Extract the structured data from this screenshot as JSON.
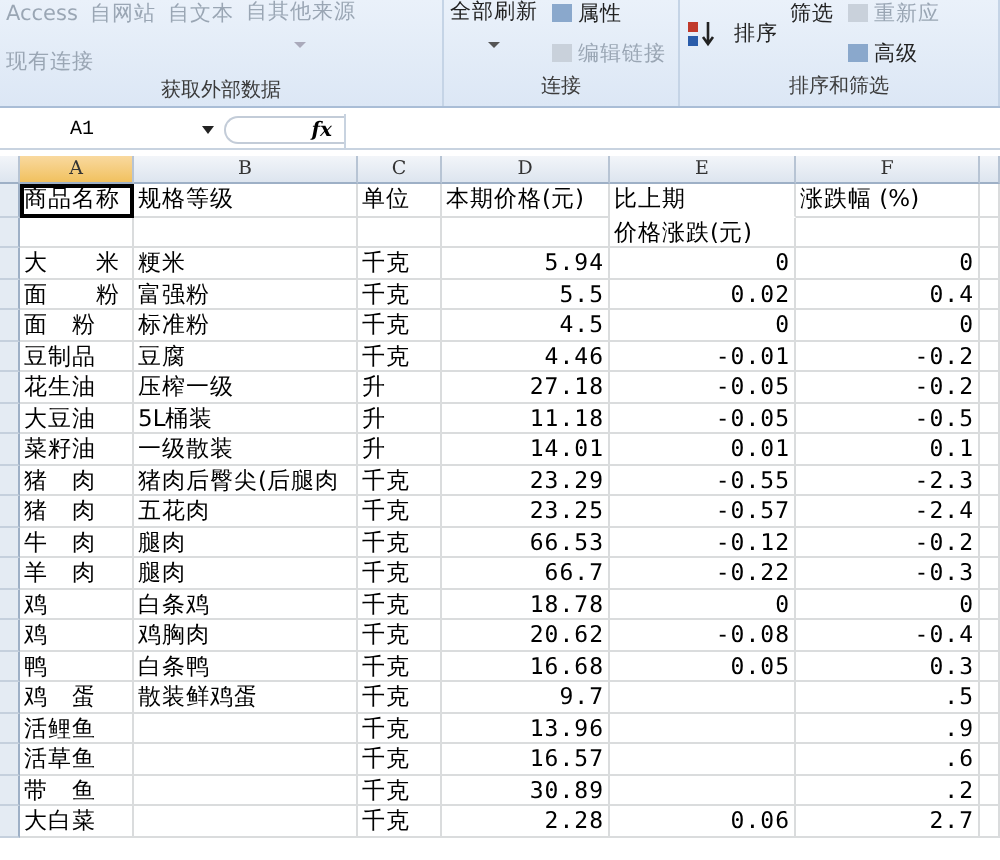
{
  "ribbon": {
    "groups": [
      {
        "label": "获取外部数据",
        "items": [
          {
            "text": "Access",
            "disabled": true,
            "kind": "big"
          },
          {
            "text": "自网站",
            "disabled": true,
            "kind": "big"
          },
          {
            "text": "自文本",
            "disabled": true,
            "kind": "big"
          },
          {
            "text": "自其他来源",
            "disabled": true,
            "kind": "menu"
          },
          {
            "text": "现有连接",
            "disabled": true,
            "kind": "big"
          }
        ]
      },
      {
        "label": "连接",
        "items": [
          {
            "text": "全部刷新",
            "disabled": false,
            "kind": "menu"
          },
          {
            "text": "属性",
            "disabled": false,
            "kind": "small"
          },
          {
            "text": "编辑链接",
            "disabled": true,
            "kind": "small"
          }
        ]
      },
      {
        "label": "排序和筛选",
        "items": [
          {
            "text": "排序",
            "disabled": false,
            "kind": "sort"
          },
          {
            "text": "筛选",
            "disabled": false,
            "kind": "big"
          },
          {
            "text": "重新应",
            "disabled": true,
            "kind": "small"
          },
          {
            "text": "高级",
            "disabled": false,
            "kind": "small"
          }
        ]
      }
    ]
  },
  "formula_bar": {
    "name_box": "A1",
    "function_label": "fx"
  },
  "sheet": {
    "columns": [
      {
        "label": "A",
        "selected": true
      },
      {
        "label": "B",
        "selected": false
      },
      {
        "label": "C",
        "selected": false
      },
      {
        "label": "D",
        "selected": false
      },
      {
        "label": "E",
        "selected": false
      },
      {
        "label": "F",
        "selected": false
      }
    ],
    "header": [
      {
        "text": "商品名称",
        "selected": true
      },
      {
        "text": "规格等级",
        "selected": false
      },
      {
        "text": "单位",
        "selected": false
      },
      {
        "text": "本期价格(元)",
        "selected": false
      },
      {
        "text": "比上期",
        "selected": false
      },
      {
        "text": "涨跌幅 (%)",
        "selected": false
      }
    ],
    "header_continuation": "价格涨跌(元)",
    "rows": [
      {
        "name": "大　　米",
        "grade": "粳米",
        "unit": "千克",
        "price": "5.94",
        "change": "0",
        "percent": "0"
      },
      {
        "name": "面　　粉",
        "grade": "富强粉",
        "unit": "千克",
        "price": "5.5",
        "change": "0.02",
        "percent": "0.4"
      },
      {
        "name": "面　粉",
        "grade": "标准粉",
        "unit": "千克",
        "price": "4.5",
        "change": "0",
        "percent": "0"
      },
      {
        "name": "豆制品",
        "grade": "豆腐",
        "unit": "千克",
        "price": "4.46",
        "change": "-0.01",
        "percent": "-0.2"
      },
      {
        "name": "花生油",
        "grade": "压榨一级",
        "unit": "升",
        "price": "27.18",
        "change": "-0.05",
        "percent": "-0.2"
      },
      {
        "name": "大豆油",
        "grade": "5L桶装",
        "unit": "升",
        "price": "11.18",
        "change": "-0.05",
        "percent": "-0.5"
      },
      {
        "name": "菜籽油",
        "grade": "一级散装",
        "unit": "升",
        "price": "14.01",
        "change": "0.01",
        "percent": "0.1"
      },
      {
        "name": "猪　肉",
        "grade": "猪肉后臀尖(后腿肉",
        "unit": "千克",
        "price": "23.29",
        "change": "-0.55",
        "percent": "-2.3"
      },
      {
        "name": "猪　肉",
        "grade": "五花肉",
        "unit": "千克",
        "price": "23.25",
        "change": "-0.57",
        "percent": "-2.4"
      },
      {
        "name": "牛　肉",
        "grade": "腿肉",
        "unit": "千克",
        "price": "66.53",
        "change": "-0.12",
        "percent": "-0.2"
      },
      {
        "name": "羊　肉",
        "grade": "腿肉",
        "unit": "千克",
        "price": "66.7",
        "change": "-0.22",
        "percent": "-0.3"
      },
      {
        "name": "鸡",
        "grade": "白条鸡",
        "unit": "千克",
        "price": "18.78",
        "change": "0",
        "percent": "0"
      },
      {
        "name": "鸡",
        "grade": "鸡胸肉",
        "unit": "千克",
        "price": "20.62",
        "change": "-0.08",
        "percent": "-0.4"
      },
      {
        "name": "鸭",
        "grade": "白条鸭",
        "unit": "千克",
        "price": "16.68",
        "change": "0.05",
        "percent": "0.3"
      },
      {
        "name": "鸡　蛋",
        "grade": "散装鲜鸡蛋",
        "unit": "千克",
        "price": "9.7",
        "percent": ".5"
      },
      {
        "name": "活鲤鱼",
        "unit": "千克",
        "price": "13.96",
        "percent": ".9"
      },
      {
        "name": "活草鱼",
        "unit": "千克",
        "price": "16.57",
        "percent": ".6"
      },
      {
        "name": "带　鱼",
        "unit": "千克",
        "price": "30.89",
        "percent": ".2"
      },
      {
        "name": "大白菜",
        "unit": "千克",
        "price": "2.28",
        "change": "0.06",
        "percent": "2.7"
      }
    ]
  }
}
